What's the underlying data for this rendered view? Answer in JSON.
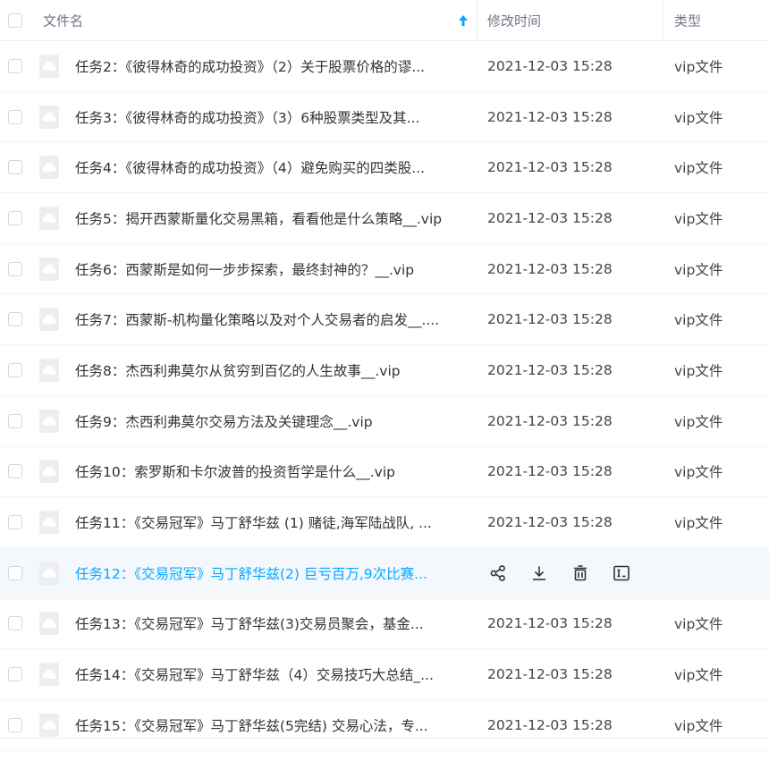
{
  "header": {
    "name_label": "文件名",
    "time_label": "修改时间",
    "type_label": "类型"
  },
  "colors": {
    "accent": "#06a7ff",
    "hover_row": "#f4f8fc"
  },
  "rows": [
    {
      "name": "任务2：《彼得林奇的成功投资》（2）关于股票价格的谬...",
      "time": "2021-12-03 15:28",
      "type": "vip文件"
    },
    {
      "name": "任务3：《彼得林奇的成功投资》（3）6种股票类型及其...",
      "time": "2021-12-03 15:28",
      "type": "vip文件"
    },
    {
      "name": "任务4：《彼得林奇的成功投资》（4）避免购买的四类股...",
      "time": "2021-12-03 15:28",
      "type": "vip文件"
    },
    {
      "name": "任务5：揭开西蒙斯量化交易黑箱，看看他是什么策略__.vip",
      "time": "2021-12-03 15:28",
      "type": "vip文件"
    },
    {
      "name": "任务6：西蒙斯是如何一步步探索，最终封神的？__.vip",
      "time": "2021-12-03 15:28",
      "type": "vip文件"
    },
    {
      "name": "任务7：西蒙斯-机构量化策略以及对个人交易者的启发__....",
      "time": "2021-12-03 15:28",
      "type": "vip文件"
    },
    {
      "name": "任务8：杰西利弗莫尔从贫穷到百亿的人生故事__.vip",
      "time": "2021-12-03 15:28",
      "type": "vip文件"
    },
    {
      "name": "任务9：杰西利弗莫尔交易方法及关键理念__.vip",
      "time": "2021-12-03 15:28",
      "type": "vip文件"
    },
    {
      "name": "任务10：索罗斯和卡尔波普的投资哲学是什么__.vip",
      "time": "2021-12-03 15:28",
      "type": "vip文件"
    },
    {
      "name": "任务11：《交易冠军》马丁舒华兹 (1) 赌徒,海军陆战队, ...",
      "time": "2021-12-03 15:28",
      "type": "vip文件"
    },
    {
      "name": "任务12：《交易冠军》马丁舒华兹(2) 巨亏百万,9次比赛...",
      "time": "",
      "type": "",
      "hover": true
    },
    {
      "name": "任务13：《交易冠军》马丁舒华兹(3)交易员聚会，基金...",
      "time": "2021-12-03 15:28",
      "type": "vip文件"
    },
    {
      "name": "任务14：《交易冠军》马丁舒华兹（4）交易技巧大总结_...",
      "time": "2021-12-03 15:28",
      "type": "vip文件"
    },
    {
      "name": "任务15：《交易冠军》马丁舒华兹(5完结) 交易心法，专...",
      "time": "2021-12-03 15:28",
      "type": "vip文件"
    }
  ],
  "hover_actions": [
    "share-icon",
    "download-icon",
    "delete-icon",
    "rename-icon"
  ]
}
